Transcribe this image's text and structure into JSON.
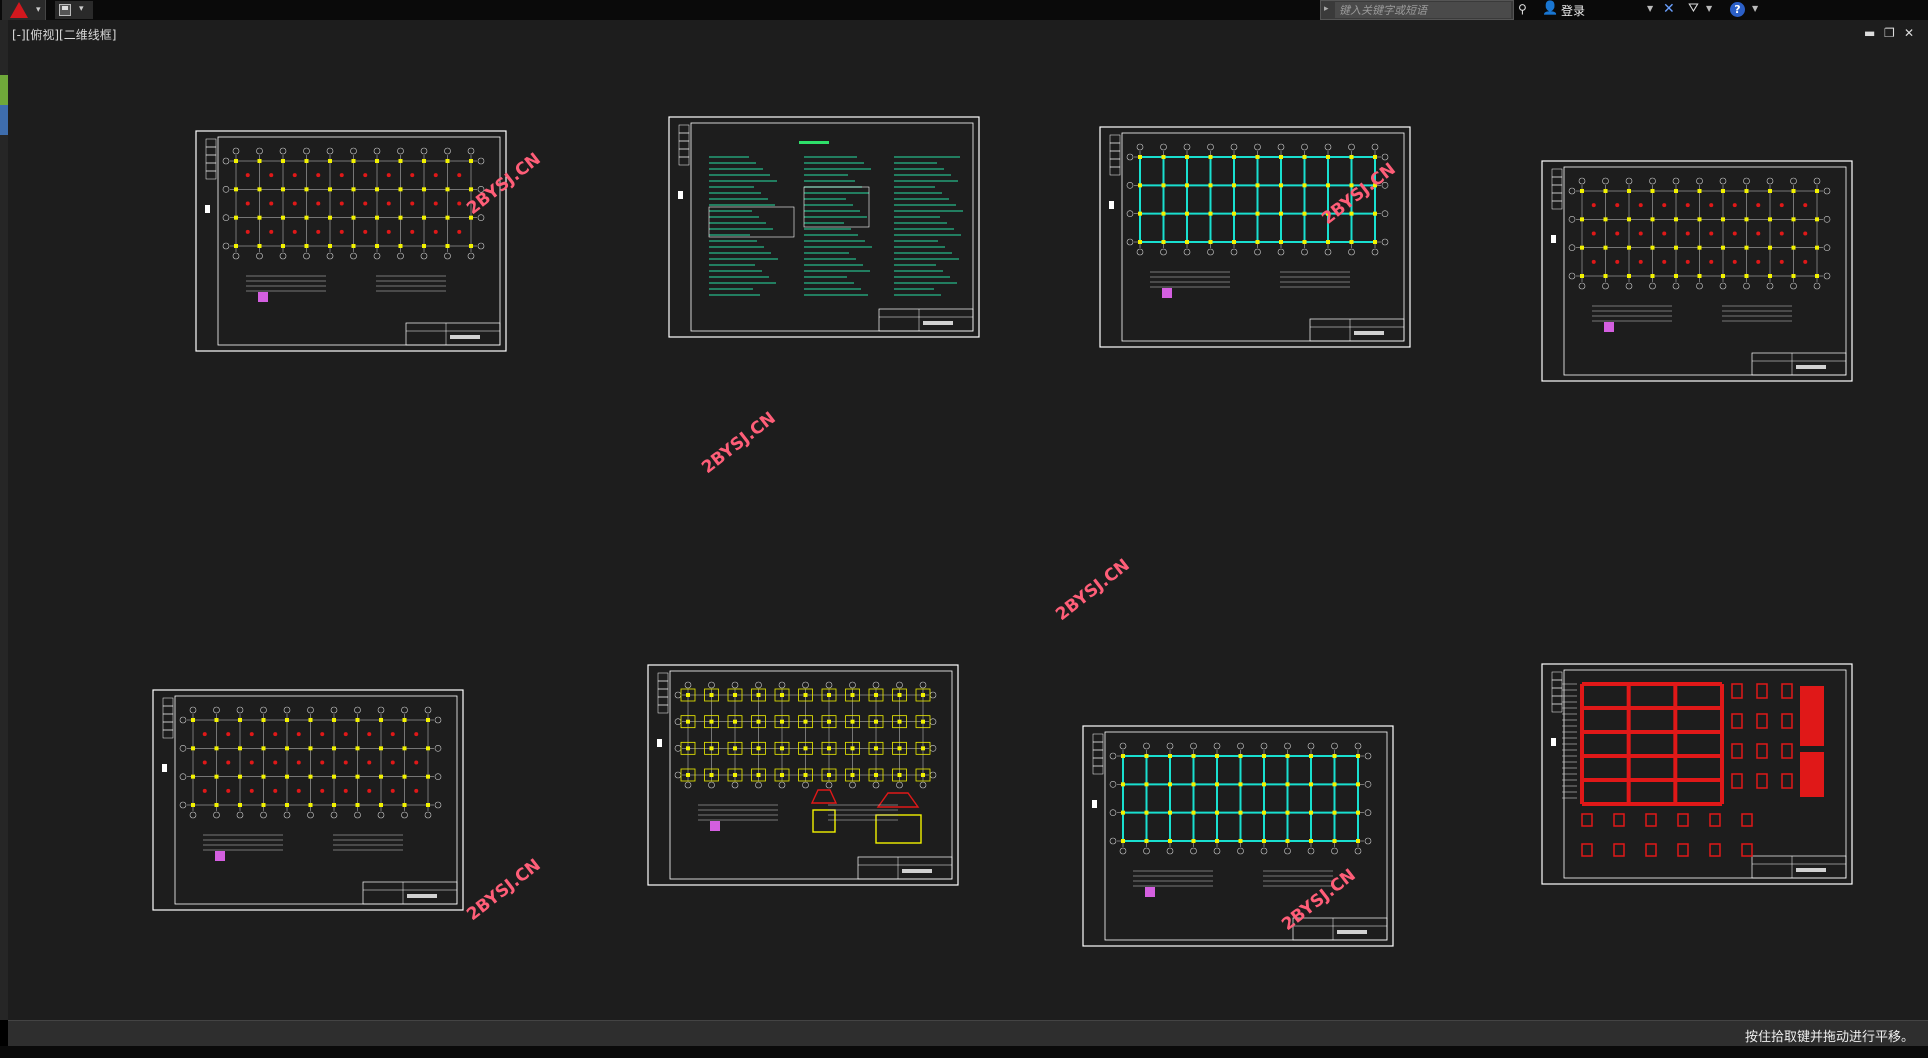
{
  "viewport_label": "[-][俯视][二维线框]",
  "search": {
    "placeholder": "键入关键字或短语"
  },
  "login_label": "登录",
  "help_label": "?",
  "status_text": "按住拾取键并拖动进行平移。",
  "watermark_text": "2BYSJ.CN",
  "icons": {
    "app": "autocad-logo-icon",
    "save": "save-icon",
    "search": "binoculars-icon",
    "user": "user-icon",
    "exchange": "x-exchange-icon",
    "a360": "a360-icon",
    "help": "help-icon"
  },
  "colors": {
    "background": "#1d1d1d",
    "frame": "#ffffff",
    "grid": "#cfcfcf",
    "beam_cyan": "#19e0d0",
    "column_yellow": "#f2f200",
    "rebar_red": "#e01818",
    "watermark": "#ff5e78",
    "note_green": "#27d49a"
  }
}
